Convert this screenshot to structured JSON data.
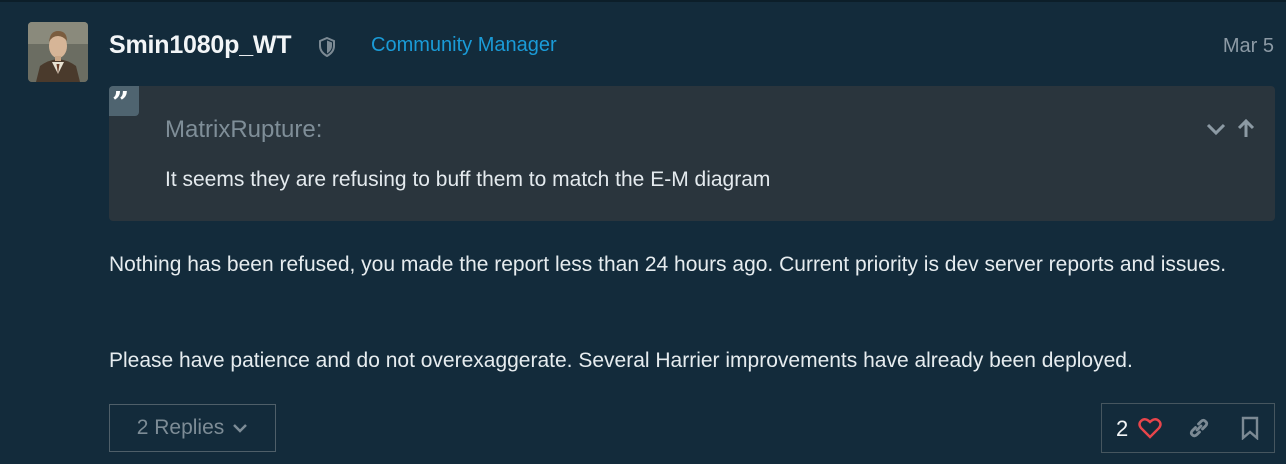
{
  "post": {
    "username": "Smin1080p_WT",
    "role": "Community Manager",
    "date": "Mar 5",
    "quote": {
      "author": "MatrixRupture:",
      "text": "It seems they are refusing to buff them to match the E-M diagram"
    },
    "paragraphs": [
      "Nothing has been refused, you made the report less than 24 hours ago. Current priority is dev server reports and issues.",
      "Please have patience and do not overexaggerate. Several Harrier improvements have already been deployed."
    ],
    "replies_label": "2 Replies",
    "like_count": "2"
  },
  "colors": {
    "background": "#132b3b",
    "role_accent": "#1a9bd7",
    "like_heart": "#e8454b",
    "quote_bg": "#2a353d"
  },
  "icons": {
    "shield": "shield-icon",
    "quote": "quote-icon",
    "collapse": "chevron-down-icon",
    "expand_up": "arrow-up-icon",
    "heart": "heart-icon",
    "link": "link-icon",
    "bookmark": "bookmark-icon",
    "replies_chevron": "chevron-down-icon"
  }
}
